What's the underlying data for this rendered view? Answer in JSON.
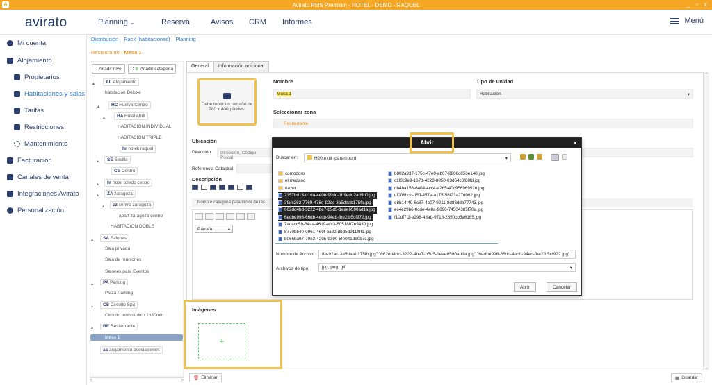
{
  "titlebar": {
    "title": "Avirato PMS Premium - HOTEL - DEMO - RAQUEL",
    "logo": "A",
    "controls": "_ ▫ x"
  },
  "topnav": {
    "logo": "avirato",
    "items": [
      "Planning",
      "Reserva",
      "Avisos",
      "CRM",
      "Informes"
    ],
    "menu": "Menú"
  },
  "sidebar": {
    "items": [
      {
        "label": "Mi cuenta",
        "icon": "user-icon"
      },
      {
        "label": "Alojamiento",
        "icon": "building-icon"
      },
      {
        "label": "Propietarios",
        "icon": "badge-icon"
      },
      {
        "label": "Habitaciones y salas",
        "icon": "bed-icon"
      },
      {
        "label": "Tarifas",
        "icon": "list-icon"
      },
      {
        "label": "Restricciones",
        "icon": "calendar-icon"
      },
      {
        "label": "Mantenimiento",
        "icon": "tools-icon"
      },
      {
        "label": "Facturación",
        "icon": "invoice-icon"
      },
      {
        "label": "Canales de venta",
        "icon": "grid-icon"
      },
      {
        "label": "Integraciones Avirato",
        "icon": "plug-icon"
      },
      {
        "label": "Personalización",
        "icon": "gear-icon"
      }
    ]
  },
  "subtabs": [
    "Distribución",
    "Rack (habitaciones)",
    "Planning"
  ],
  "breadcrumb": {
    "parent": "Restaurante",
    "sep": "›",
    "current": "Mesa 1"
  },
  "tree": {
    "add_level": "Añadir nivel",
    "add_category": "Añadir categoría",
    "nodes": [
      {
        "code": "AL",
        "label": "Alojamiento"
      },
      {
        "code": "",
        "label": "habitacion Deluxe"
      },
      {
        "code": "HC",
        "label": "Huelva Centro"
      },
      {
        "code": "HA",
        "label": "Hotel Abril"
      },
      {
        "code": "",
        "label": "HABITACION INDIVIDUAL"
      },
      {
        "code": "",
        "label": "HABITACION TRIPLE"
      },
      {
        "code": "hr",
        "label": "hotek raquel"
      },
      {
        "code": "SE",
        "label": "Sevilla"
      },
      {
        "code": "CE",
        "label": "Centro"
      },
      {
        "code": "ht",
        "label": "hotel toledo centro"
      },
      {
        "code": "ZA",
        "label": "zaragoza"
      },
      {
        "code": "cz",
        "label": "centro zaragoza"
      },
      {
        "code": "",
        "label": "apart zaragoza centro"
      },
      {
        "code": "",
        "label": "HABITACION DOBLE"
      },
      {
        "code": "SA",
        "label": "Salones"
      },
      {
        "code": "",
        "label": "Sala privada"
      },
      {
        "code": "",
        "label": "Sala de reuniones"
      },
      {
        "code": "",
        "label": "Salones para Eventos"
      },
      {
        "code": "PA",
        "label": "Parking"
      },
      {
        "code": "",
        "label": "Plaza Parking"
      },
      {
        "code": "CS",
        "label": "Circuito Spa"
      },
      {
        "code": "",
        "label": "Circuito termolúdico 1h30min"
      },
      {
        "code": "RE",
        "label": "Restaurante"
      },
      {
        "code": "",
        "label": "Mesa 1"
      },
      {
        "code": "aa",
        "label": "alojamiento asociaciones"
      }
    ]
  },
  "main": {
    "tabs": [
      "General",
      "Información adicional"
    ],
    "image_hint": "Debe tener un tamaño de 780 x 400 píxeles.",
    "nombre_label": "Nombre",
    "nombre_value": "Mesa 1",
    "tipo_label": "Tipo de unidad",
    "tipo_value": "Habitación",
    "zona_label": "Seleccionar zona",
    "zona_value": "Restaurante",
    "ubicacion_label": "Ubicación",
    "direccion_label": "Dirección",
    "direccion_placeholder": "Dirección, Código Postal",
    "catastral_label": "Referencia Catastral",
    "descripcion_label": "Descripción",
    "category_bar": "Nombre categoría para motor de res",
    "parrafo": "Párrafo",
    "imagenes_label": "Imágenes",
    "plus": "+",
    "delete_btn": "Eliminar",
    "save_btn": "Guardar"
  },
  "dialog": {
    "title": "Abrir",
    "close": "×",
    "lookin_label": "Buscar en:",
    "lookin_value": "H20textil -paramount",
    "files_left": [
      {
        "name": "comodoro",
        "type": "folder",
        "selected": false
      },
      {
        "name": "el medano",
        "type": "folder",
        "selected": false
      },
      {
        "name": "riazor",
        "type": "folder",
        "selected": false
      },
      {
        "name": "2357bd13-d1da-4e0b-99dd-1b9edd2ad5d0.jpg",
        "type": "file",
        "selected": true
      },
      {
        "name": "3fafc282-7769-478e-92ac-3a5daab175fb.jpg",
        "type": "file",
        "selected": true
      },
      {
        "name": "662dd4bd-3222-4be7-b5d5-1eae6590ad1a.jpg",
        "type": "file",
        "selected": true
      },
      {
        "name": "6edbe996-66db-4ecb-94eb-fbe2fb5cf972.jpg",
        "type": "file",
        "selected": true
      },
      {
        "name": "7acacc59-64aa-46d9-afc3-6051807e9430.jpg",
        "type": "file",
        "selected": false
      },
      {
        "name": "8770bb40-0961-469f-ba82-dbd5d911f9f1.jpg",
        "type": "file",
        "selected": false
      },
      {
        "name": "b066ba97-70e2-4295-9390-5fe041db9b7c.jpg",
        "type": "file",
        "selected": false
      }
    ],
    "files_right": [
      {
        "name": "b802a937-175c-47e0-ab07-8806c656e140.jpg",
        "type": "file"
      },
      {
        "name": "c1f0c9e9-167d-4228-8850-03d54c0f88fd.jpg",
        "type": "file"
      },
      {
        "name": "db4ba158-6404-4cc4-a265-40c95696952e.jpg",
        "type": "file"
      },
      {
        "name": "df008bcd-d5ff-457e-a175-58f23a27d062.jpg",
        "type": "file"
      },
      {
        "name": "e8b14f40-6c87-4b07-9211-8d88ddb77743.jpg",
        "type": "file"
      },
      {
        "name": "ec4e29b6-0cde-4e8a-9696-74504385f70a.jpg",
        "type": "file"
      },
      {
        "name": "f10df7f2-e298-48ab-9718-2850cb5a6165.jpg",
        "type": "file"
      }
    ],
    "filename_label": "Nombre de Archivo",
    "filename_value": "8e-92ac-3a5daab175fb.jpg\" \"662dd4bd-3222-4be7-b5d5-1eae6590ad1a.jpg\" \"6edbe996-66db-4ecb-94eb-fbe2fb5cf972.jpg\"",
    "filetype_label": "Archivos de tipo",
    "filetype_value": "jpg, png, gif",
    "open_btn": "Abrir",
    "cancel_btn": "Cancelar"
  },
  "colors": {
    "accent": "#f5a623",
    "brand": "#2c3e6b",
    "link": "#2d7bc8",
    "highlight": "#f0c24c"
  }
}
